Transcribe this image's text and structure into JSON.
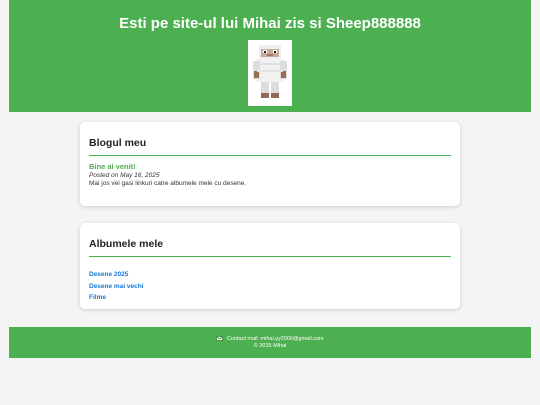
{
  "header": {
    "title": "Esti pe site-ul lui Mihai zis si Sheep888888",
    "avatar": "sheep-avatar"
  },
  "blog": {
    "heading": "Blogul meu",
    "posts": [
      {
        "title": "Bine ai venit!",
        "posted_on": "Posted on May 16, 2025",
        "body": "Mai jos vei gasi linkuri catre albumele mele cu desene."
      }
    ]
  },
  "albums": {
    "heading": "Albumele mele",
    "items": [
      {
        "label": "Desene 2025"
      },
      {
        "label": "Desene mai vechi"
      },
      {
        "label": "Filme"
      }
    ]
  },
  "footer": {
    "contact_icon": "envelope-icon",
    "contact": "Contact mail: mihai.yy2000@gmail.com",
    "copyright": "© 2025 Mihai"
  },
  "colors": {
    "accent": "#4caf50",
    "link": "#1677d2",
    "background": "#f4f4f4"
  }
}
